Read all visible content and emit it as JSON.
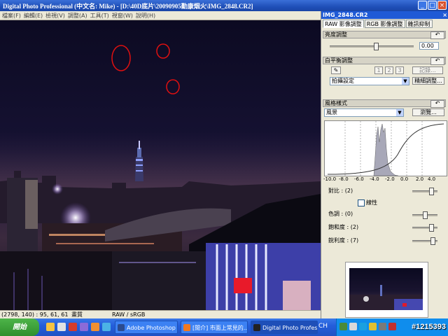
{
  "window": {
    "title": "Digital Photo Professional (中文名: Mike) - [D:\\40D底片\\20090905勤康烟火\\IMG_2848.CR2]",
    "buttons": [
      "_",
      "□",
      "×"
    ]
  },
  "menu": [
    "檔案(F)",
    "編輯(E)",
    "檢視(V)",
    "調整(A)",
    "工具(T)",
    "視窗(W)",
    "說明(H)"
  ],
  "status": {
    "coords": "(2798, 140) :  95, 61, 61",
    "quality": "畫質",
    "colorspace": "RAW / sRGB"
  },
  "panel": {
    "title": "IMG_2848.CR2",
    "close": "×",
    "tabs": [
      "RAW 影像調整",
      "RGB 影像調整",
      "雜訊抑制"
    ],
    "brightness": {
      "label": "亮度調整",
      "value": "0.00",
      "reset": "↶",
      "level": 0.55
    },
    "wb": {
      "label": "白平衡調整",
      "reset": "↶",
      "eyedropper": "✎",
      "presets": [
        "1",
        "2",
        "3"
      ],
      "register": "記錄...",
      "select": "拍攝設定",
      "fine": "精細調整..."
    },
    "picture_style": {
      "label": "風格樣式",
      "reset": "↶",
      "select": "風景",
      "browse": "瀏覽..."
    },
    "hist_ticks": [
      "-10.0",
      "-8.0",
      "-6.0",
      "-4.0",
      "-2.0",
      "0.0",
      "2.0",
      "4.0"
    ],
    "contrast": {
      "label": "對比 : (2)",
      "level": 0.8
    },
    "linear": {
      "label": "線性"
    },
    "hue": {
      "label": "色調 : (0)",
      "level": 0.5
    },
    "saturation": {
      "label": "飽和度 : (2)",
      "level": 0.8
    },
    "sharpness": {
      "label": "銳利度 : (7)",
      "level": 0.85
    }
  },
  "taskbar": {
    "start": "開始",
    "tasks": [
      {
        "label": "Adobe Photoshop C...",
        "active": false
      },
      {
        "label": "[閒介] 市面上常見的...",
        "active": false
      },
      {
        "label": "Digital Photo Profess...",
        "active": true
      }
    ],
    "tray_lang": "CH",
    "watermark": "#1215393"
  },
  "colors": {
    "title_blue": "#1f5ad6",
    "panel_bg": "#ece9d8",
    "taskbar_blue": "#245edb",
    "circle_red": "#e01010"
  }
}
